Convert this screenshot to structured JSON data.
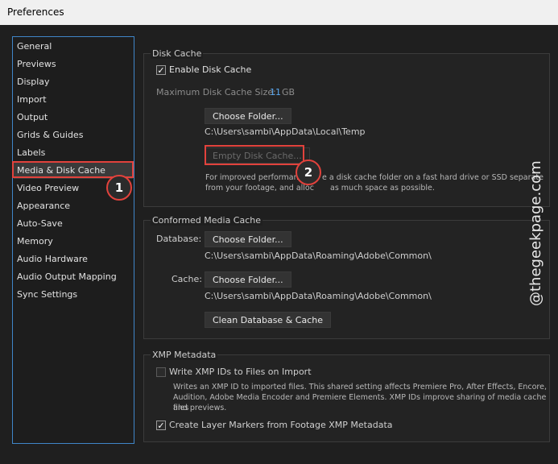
{
  "window": {
    "title": "Preferences"
  },
  "sidebar": {
    "items": [
      {
        "label": "General"
      },
      {
        "label": "Previews"
      },
      {
        "label": "Display"
      },
      {
        "label": "Import"
      },
      {
        "label": "Output"
      },
      {
        "label": "Grids & Guides"
      },
      {
        "label": "Labels"
      },
      {
        "label": "Media & Disk Cache",
        "selected": true
      },
      {
        "label": "Video Preview"
      },
      {
        "label": "Appearance"
      },
      {
        "label": "Auto-Save"
      },
      {
        "label": "Memory"
      },
      {
        "label": "Audio Hardware"
      },
      {
        "label": "Audio Output Mapping"
      },
      {
        "label": "Sync Settings"
      }
    ]
  },
  "annotations": {
    "badge1": "1",
    "badge2": "2",
    "highlight_color": "#e2423c"
  },
  "disk_cache": {
    "title": "Disk Cache",
    "enable_label": "Enable Disk Cache",
    "enable_checked": true,
    "max_size_label": "Maximum Disk Cache Size:",
    "max_size_value": "11",
    "max_size_unit": "GB",
    "choose_folder": "Choose Folder...",
    "path": "C:\\Users\\sambi\\AppData\\Local\\Temp",
    "empty_cache": "Empty Disk Cache...",
    "info_line1": "For improved performanc",
    "info_line1_end": "e a disk cache folder on a fast hard drive or SSD separate",
    "info_line2": "from your footage, and alloc",
    "info_line2_end": "as much space as possible."
  },
  "conformed": {
    "title": "Conformed Media Cache",
    "database_label": "Database:",
    "database_button": "Choose Folder...",
    "database_path": "C:\\Users\\sambi\\AppData\\Roaming\\Adobe\\Common\\",
    "cache_label": "Cache:",
    "cache_button": "Choose Folder...",
    "cache_path": "C:\\Users\\sambi\\AppData\\Roaming\\Adobe\\Common\\",
    "clean_button": "Clean Database & Cache"
  },
  "xmp": {
    "title": "XMP Metadata",
    "write_ids_label": "Write XMP IDs to Files on Import",
    "write_ids_checked": false,
    "description_line1": "Writes an XMP ID to imported files. This shared setting affects Premiere Pro, After Effects, Encore,",
    "description_line2": "Audition, Adobe Media Encoder and Premiere Elements. XMP IDs improve sharing of media cache files",
    "description_line3": "and previews.",
    "layer_markers_label": "Create Layer Markers from Footage XMP Metadata",
    "layer_markers_checked": true
  },
  "watermark": {
    "text": "@thegeekpage.com"
  }
}
